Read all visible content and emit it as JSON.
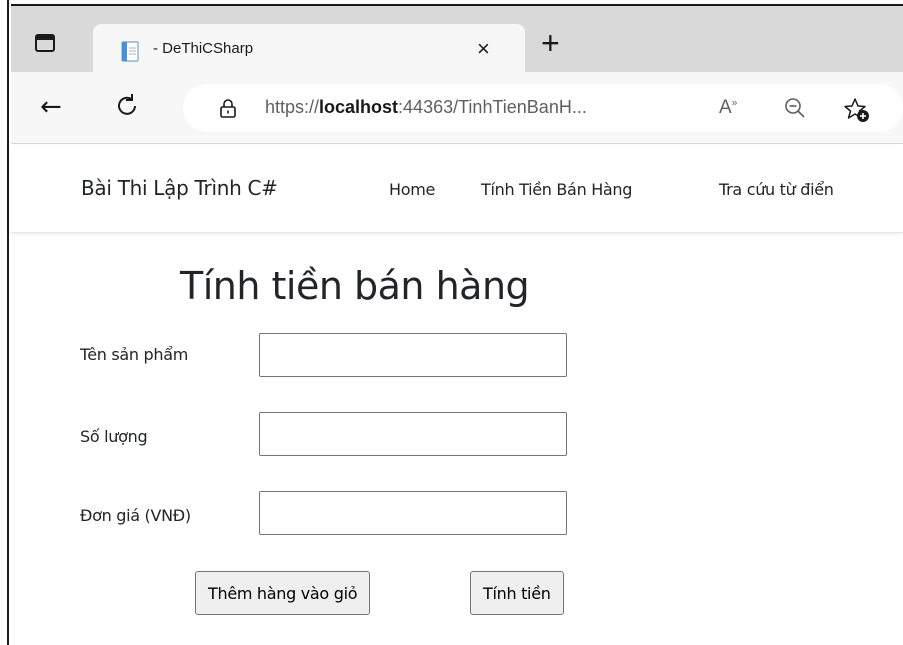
{
  "browser": {
    "tab": {
      "title": "- DeThiCSharp",
      "close_glyph": "×"
    },
    "new_tab_glyph": "+",
    "toolbar": {
      "back_glyph": "←",
      "url_prefix": "https://",
      "url_host": "localhost",
      "url_rest": ":44363/TinhTienBanH...",
      "read_aloud_glyph": "A",
      "read_aloud_mark": "»"
    },
    "icons": [
      "window-menu-icon",
      "page-favicon-icon",
      "close-icon",
      "new-tab-icon",
      "back-arrow-icon",
      "reload-icon",
      "lock-icon",
      "read-aloud-icon",
      "zoom-out-icon",
      "add-favorite-icon"
    ]
  },
  "navbar": {
    "brand": "Bài Thi Lập Trình C#",
    "links": [
      "Home",
      "Tính Tiền Bán Hàng",
      "Tra cứu từ điển"
    ]
  },
  "main": {
    "title": "Tính tiền bán hàng",
    "fields": [
      {
        "label": "Tên sản phẩm",
        "value": ""
      },
      {
        "label": "Số lượng",
        "value": ""
      },
      {
        "label": "Đơn giá (VNĐ)",
        "value": ""
      }
    ],
    "buttons": {
      "add_to_cart": "Thêm hàng vào giỏ",
      "calculate": "Tính tiền"
    }
  },
  "colors": {
    "tabstrip": "#d9d9d9",
    "toolbar": "#f7f7f7",
    "text": "#212529",
    "button_bg": "#efefef",
    "input_border": "#767676"
  }
}
